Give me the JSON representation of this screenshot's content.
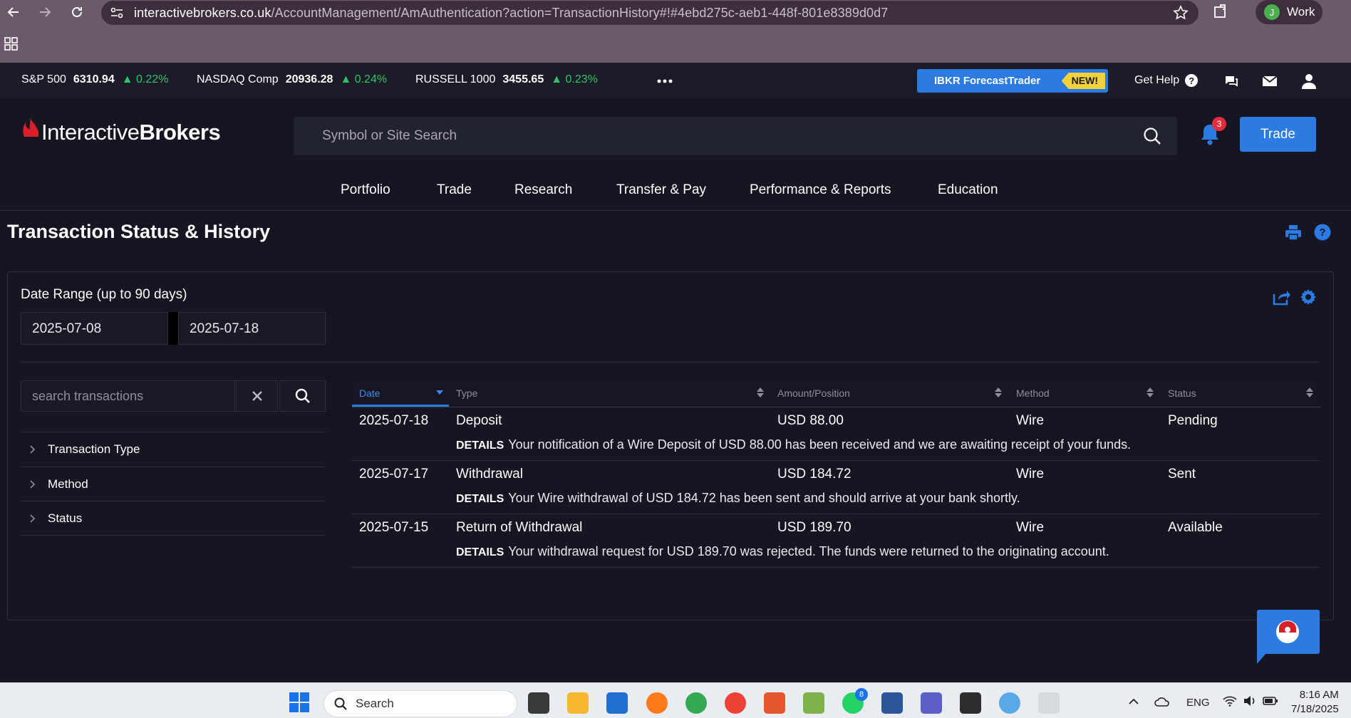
{
  "browser": {
    "url_host": "interactivebrokers.co.uk",
    "url_path": "/AccountManagement/AmAuthentication?action=TransactionHistory#!#4ebd275c-aeb1-448f-801e8389d0d7",
    "profile_initial": "J",
    "profile_label": "Work"
  },
  "ticker": [
    {
      "name": "S&P 500",
      "value": "6310.94",
      "change": "▲ 0.22%"
    },
    {
      "name": "NASDAQ Comp",
      "value": "20936.28",
      "change": "▲ 0.24%"
    },
    {
      "name": "RUSSELL 1000",
      "value": "3455.65",
      "change": "▲ 0.23%"
    }
  ],
  "topbar": {
    "forecast_label": "IBKR ForecastTrader",
    "forecast_badge": "NEW!",
    "get_help": "Get Help",
    "help_glyph": "?"
  },
  "header": {
    "logo_light": "Interactive",
    "logo_bold": "Brokers",
    "search_placeholder": "Symbol or Site Search",
    "notification_count": "3",
    "trade_label": "Trade"
  },
  "nav": {
    "items": [
      "Portfolio",
      "Trade",
      "Research",
      "Transfer & Pay",
      "Performance & Reports",
      "Education"
    ]
  },
  "page": {
    "title": "Transaction Status & History"
  },
  "filters": {
    "date_range_label": "Date Range (up to 90 days)",
    "start_date": "2025-07-08",
    "end_date": "2025-07-18",
    "search_placeholder": "search transactions",
    "groups": [
      "Transaction Type",
      "Method",
      "Status"
    ]
  },
  "table": {
    "columns": [
      "Date",
      "Type",
      "Amount/Position",
      "Method",
      "Status"
    ],
    "rows": [
      {
        "date": "2025-07-18",
        "type": "Deposit",
        "amount": "USD 88.00",
        "method": "Wire",
        "status": "Pending",
        "details_label": "DETAILS",
        "details": "Your notification of a Wire Deposit of USD 88.00 has been received and we are awaiting receipt of your funds."
      },
      {
        "date": "2025-07-17",
        "type": "Withdrawal",
        "amount": "USD 184.72",
        "method": "Wire",
        "status": "Sent",
        "details_label": "DETAILS",
        "details": "Your Wire withdrawal of USD 184.72 has been sent and should arrive at your bank shortly."
      },
      {
        "date": "2025-07-15",
        "type": "Return of Withdrawal",
        "amount": "USD 189.70",
        "method": "Wire",
        "status": "Available",
        "details_label": "DETAILS",
        "details": "Your withdrawal request for USD 189.70 was rejected. The funds were returned to the originating account."
      }
    ]
  },
  "taskbar": {
    "search_label": "Search",
    "whatsapp_badge": "8",
    "language": "ENG",
    "time": "8:16 AM",
    "date": "7/18/2025"
  },
  "colors": {
    "accent": "#2b7be3",
    "positive": "#2fc46a",
    "background": "#151621",
    "badge": "#e02e3c",
    "new_badge": "#f2d23a"
  }
}
